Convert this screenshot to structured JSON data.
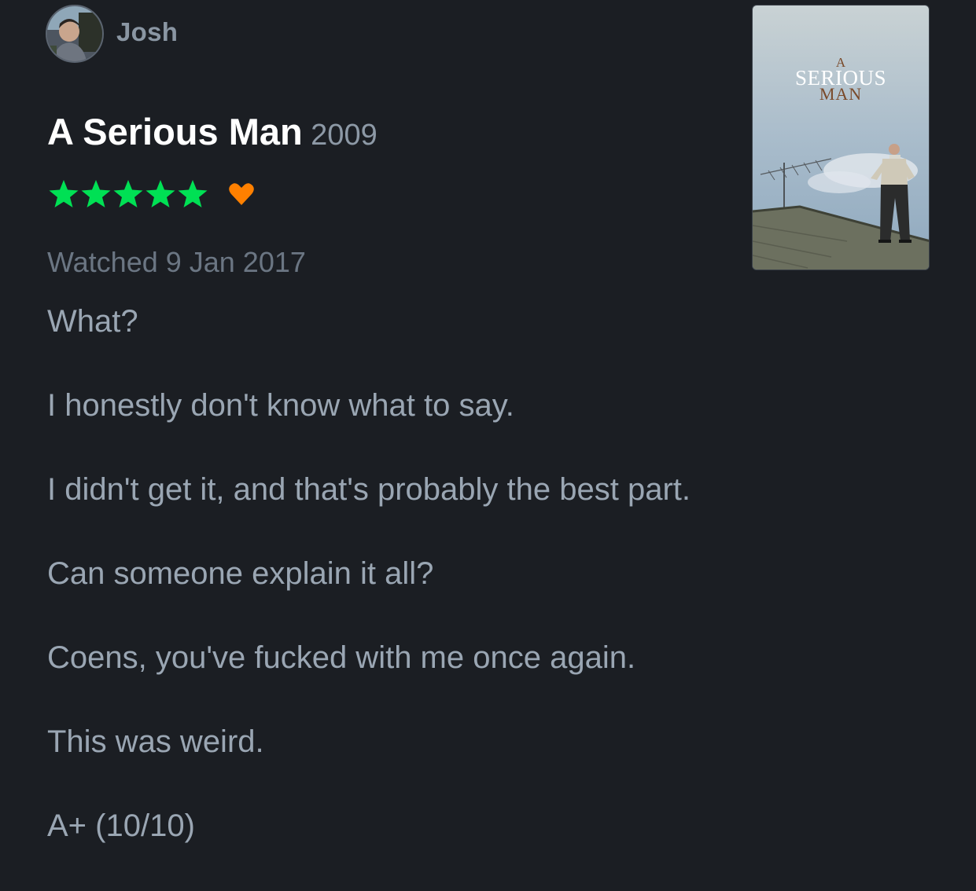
{
  "review": {
    "author": {
      "name": "Josh",
      "avatar_icon": "user-avatar-photo"
    },
    "film": {
      "title": "A Serious Man",
      "year": "2009"
    },
    "rating": {
      "stars": 5,
      "max_stars": 5,
      "star_color": "#00e054",
      "liked": true,
      "heart_color": "#ff8000"
    },
    "watched_label": "Watched 9 Jan 2017",
    "paragraphs": [
      "What?",
      "I honestly don't know what to say.",
      "I didn't get it, and that's probably the best part.",
      "Can someone explain it all?",
      "Coens, you've fucked with me once again.",
      "This was weird.",
      "A+ (10/10)"
    ],
    "poster": {
      "line1": "A",
      "line2": "SERIOUS",
      "line3": "MAN"
    }
  },
  "colors": {
    "background": "#1b1e23",
    "title": "#ffffff",
    "muted": "#8d99a6",
    "body_text": "#9aa6b3"
  }
}
